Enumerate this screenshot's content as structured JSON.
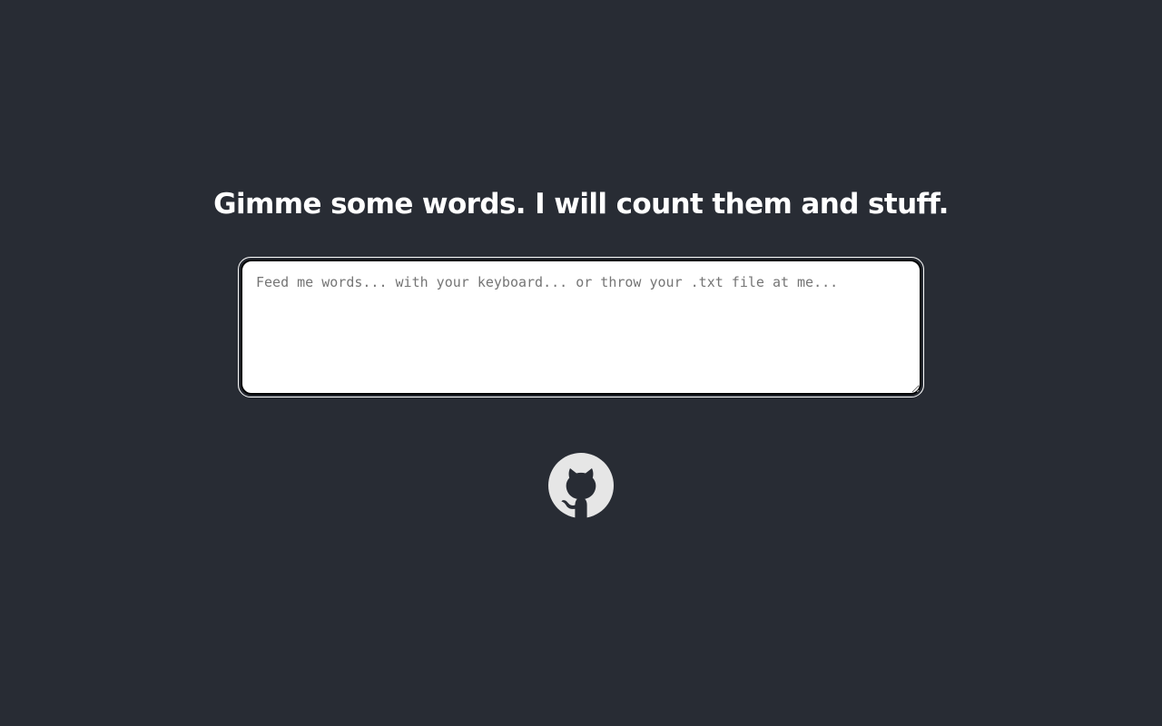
{
  "headline": "Gimme some words. I will count them and stuff.",
  "input": {
    "placeholder": "Feed me words... with your keyboard... or throw your .txt file at me...",
    "value": ""
  },
  "footer": {
    "link_icon": "github-icon"
  },
  "colors": {
    "background": "#282c34",
    "headline": "#ffffff",
    "textarea_bg": "#ffffff",
    "icon": "#e6e6e6"
  }
}
